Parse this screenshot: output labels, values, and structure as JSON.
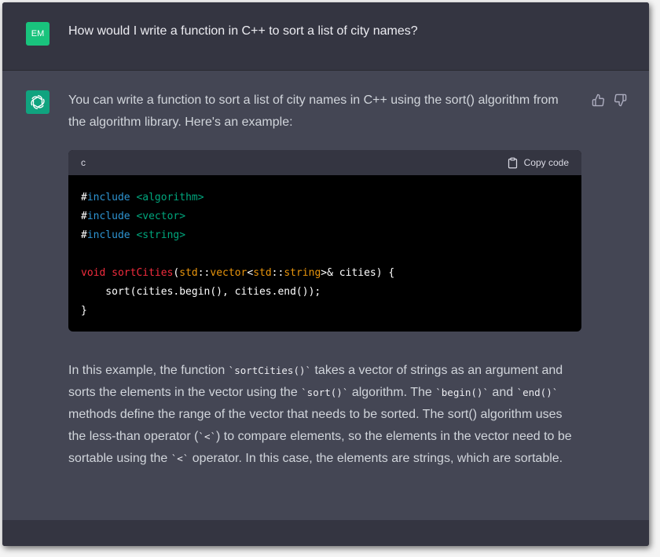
{
  "user": {
    "avatar_initials": "EM",
    "question": "How would I write a function in C++ to sort a list of city names?"
  },
  "assistant": {
    "intro": "You can write a function to sort a list of city names in C++ using the sort() algorithm from the algorithm library. Here's an example:",
    "code_block": {
      "language": "c",
      "copy_label": "Copy code",
      "lines": [
        {
          "tokens": [
            {
              "t": "#",
              "c": "hash"
            },
            {
              "t": "include",
              "c": "kw"
            },
            {
              "t": " <algorithm>",
              "c": "inc"
            }
          ]
        },
        {
          "tokens": [
            {
              "t": "#",
              "c": "hash"
            },
            {
              "t": "include",
              "c": "kw"
            },
            {
              "t": " <vector>",
              "c": "inc"
            }
          ]
        },
        {
          "tokens": [
            {
              "t": "#",
              "c": "hash"
            },
            {
              "t": "include",
              "c": "kw"
            },
            {
              "t": " <string>",
              "c": "inc"
            }
          ]
        },
        {
          "tokens": []
        },
        {
          "tokens": [
            {
              "t": "void",
              "c": "type"
            },
            {
              "t": " ",
              "c": "plain"
            },
            {
              "t": "sortCities",
              "c": "fn"
            },
            {
              "t": "(",
              "c": "plain"
            },
            {
              "t": "std",
              "c": "std"
            },
            {
              "t": "::",
              "c": "plain"
            },
            {
              "t": "vector",
              "c": "std"
            },
            {
              "t": "<",
              "c": "plain"
            },
            {
              "t": "std",
              "c": "std"
            },
            {
              "t": "::",
              "c": "plain"
            },
            {
              "t": "string",
              "c": "std"
            },
            {
              "t": ">& cities) {",
              "c": "plain"
            }
          ]
        },
        {
          "tokens": [
            {
              "t": "    sort(cities.begin(), cities.end());",
              "c": "plain"
            }
          ]
        },
        {
          "tokens": [
            {
              "t": "}",
              "c": "plain"
            }
          ]
        }
      ]
    },
    "explanation_parts": [
      {
        "text": "In this example, the function ",
        "code": false
      },
      {
        "text": "`sortCities()`",
        "code": true
      },
      {
        "text": " takes a vector of strings as an argument and sorts the elements in the vector using the ",
        "code": false
      },
      {
        "text": "`sort()`",
        "code": true
      },
      {
        "text": " algorithm. The ",
        "code": false
      },
      {
        "text": "`begin()`",
        "code": true
      },
      {
        "text": " and ",
        "code": false
      },
      {
        "text": "`end()`",
        "code": true
      },
      {
        "text": " methods define the range of the vector that needs to be sorted. The sort() algorithm uses the less-than operator (",
        "code": false
      },
      {
        "text": "`<`",
        "code": true
      },
      {
        "text": ") to compare elements, so the elements in the vector need to be sortable using the ",
        "code": false
      },
      {
        "text": "`<`",
        "code": true
      },
      {
        "text": " operator. In this case, the elements are strings, which are sortable.",
        "code": false
      }
    ]
  },
  "icons": {
    "thumbs_up": "thumbs-up-icon",
    "thumbs_down": "thumbs-down-icon",
    "clipboard": "clipboard-icon",
    "openai_logo": "openai-logo-icon"
  },
  "colors": {
    "user_avatar": "#19c37d",
    "bot_avatar": "#10a37f",
    "page_bg": "#343541",
    "assistant_bg": "#444654"
  }
}
